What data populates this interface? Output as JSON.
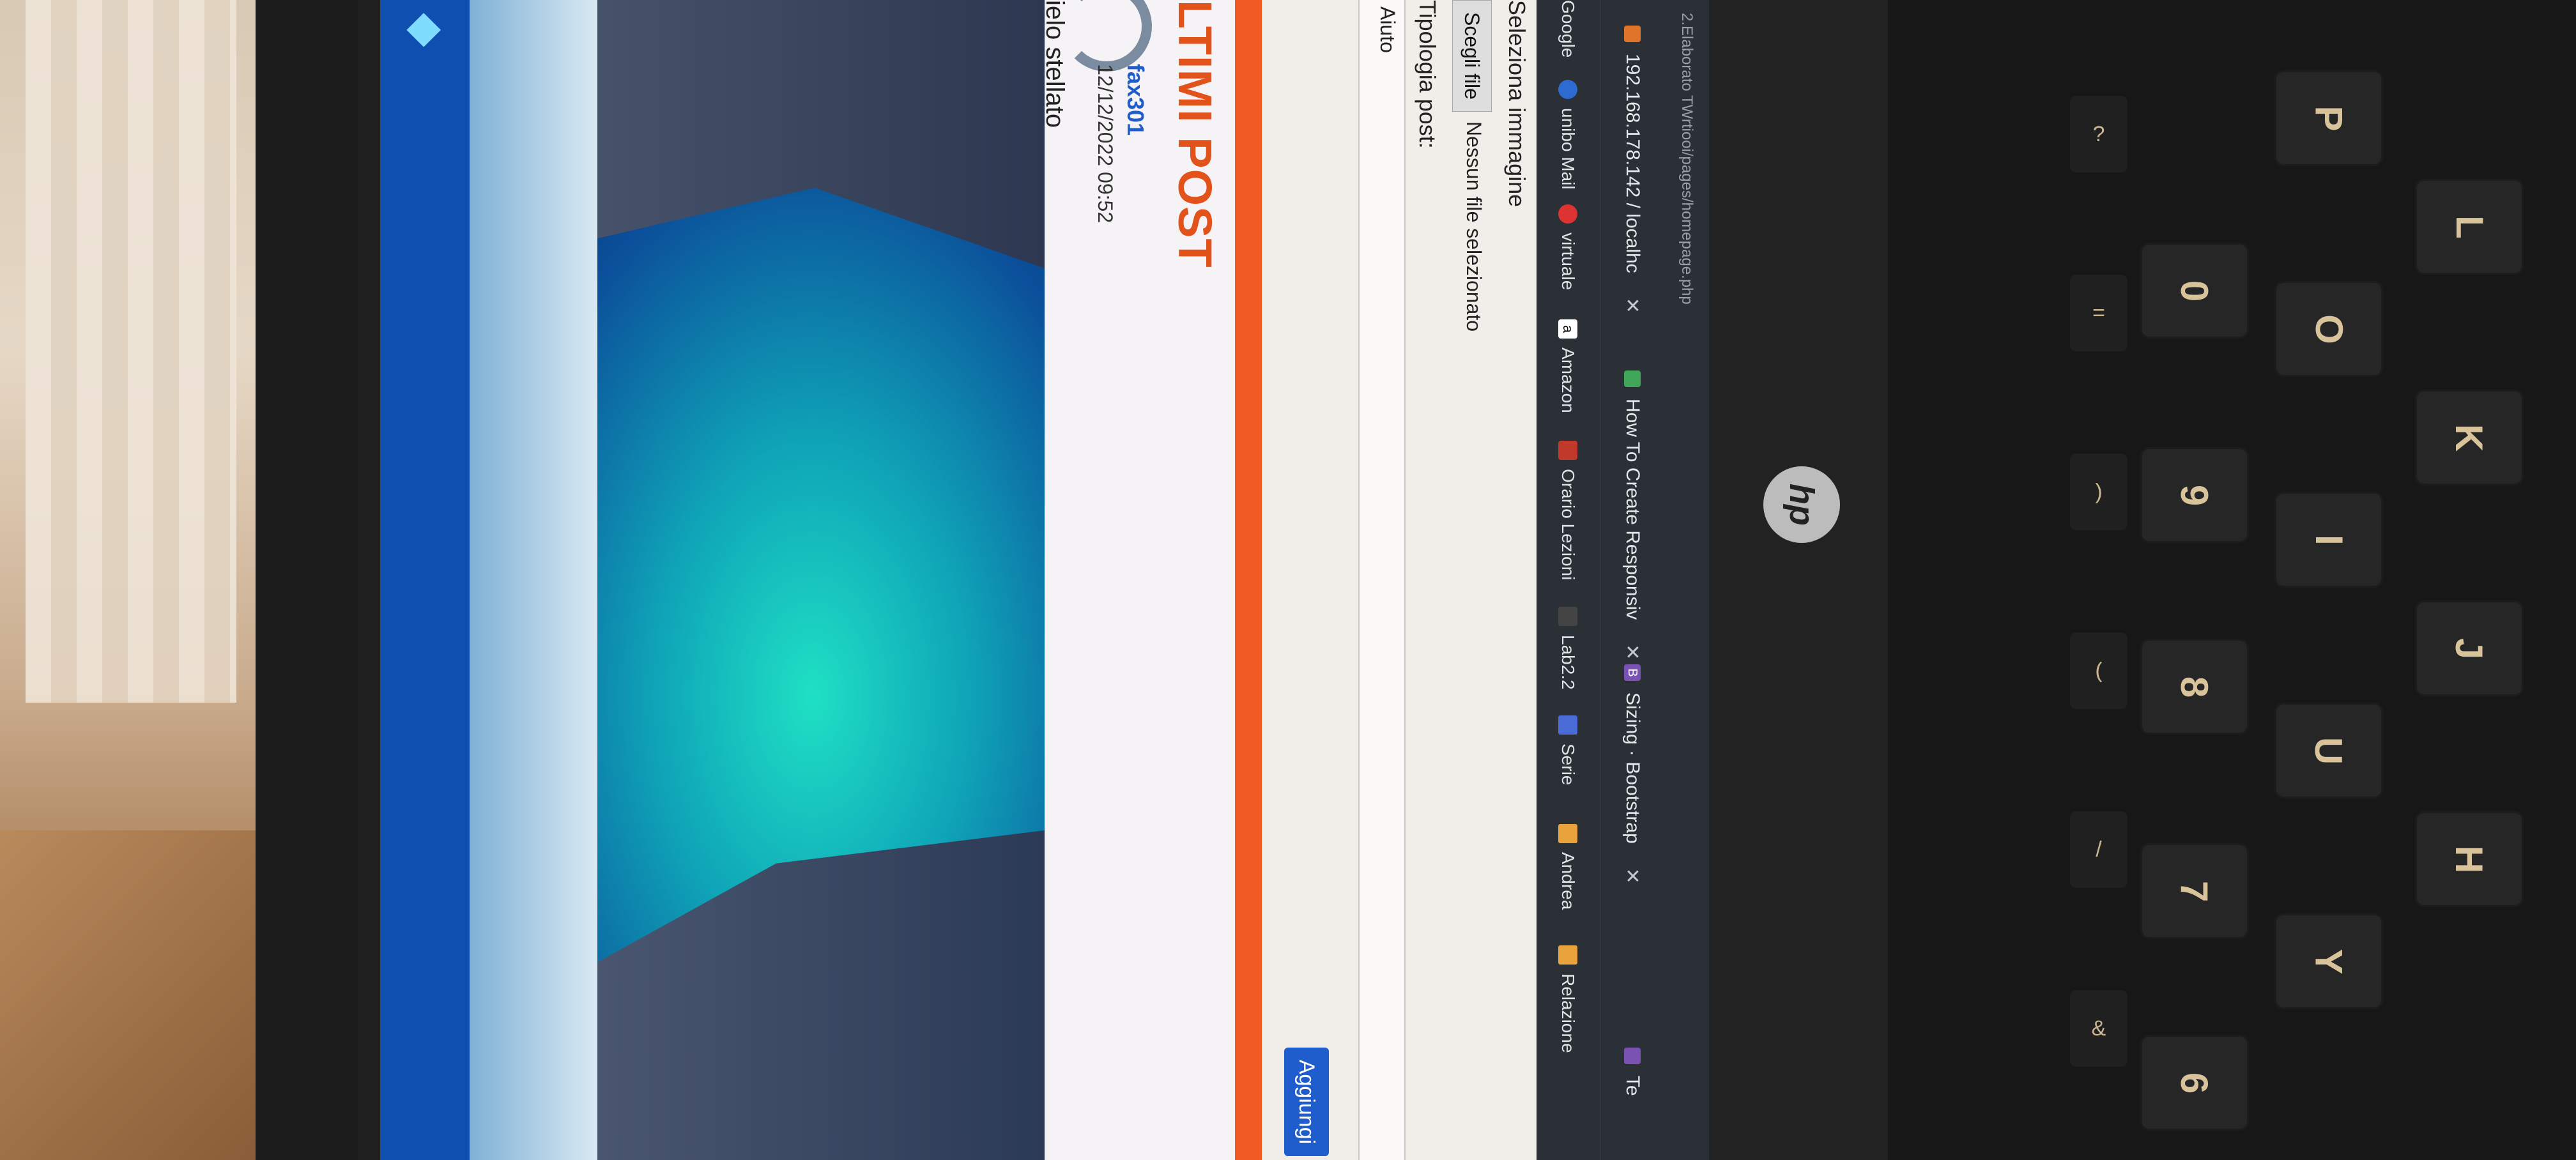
{
  "browser": {
    "tabs": [
      {
        "label": "192.168.178.142 / localhc"
      },
      {
        "label": "How To Create Responsiv"
      },
      {
        "label": "Sizing · Bootstrap"
      },
      {
        "label": "Te"
      }
    ],
    "url": "2.Elaborato TWrtiooi/pages/homepage.php",
    "bookmarks": [
      {
        "label": "Google"
      },
      {
        "label": "unibo Mail"
      },
      {
        "label": "virtuale"
      },
      {
        "label": "Amazon"
      },
      {
        "label": "Orario Lezioni"
      },
      {
        "label": "Lab2.2"
      },
      {
        "label": "Serie"
      },
      {
        "label": "Andrea"
      },
      {
        "label": "Relazione"
      }
    ]
  },
  "form": {
    "image_label": "Seleziona immagine",
    "file_button": "Scegli file",
    "file_status": "Nessun file selezionato",
    "type_label": "Tipologia post:",
    "type_value": "Aiuto",
    "submit_label": "Aggiungi"
  },
  "posts": {
    "section_title": "LTIMI POST",
    "items": [
      {
        "author": "fax301",
        "date": "12/12/2022 09:52",
        "title": "ielo stellato"
      }
    ]
  },
  "laptop": {
    "brand": "hp",
    "keys": [
      "P",
      "O",
      "I",
      "U",
      "Y",
      "L",
      "K",
      "J",
      "H",
      "0",
      "9",
      "8",
      "7",
      "6"
    ],
    "fkeys": [
      "?",
      "=",
      ")",
      "(",
      "/",
      "&"
    ]
  }
}
